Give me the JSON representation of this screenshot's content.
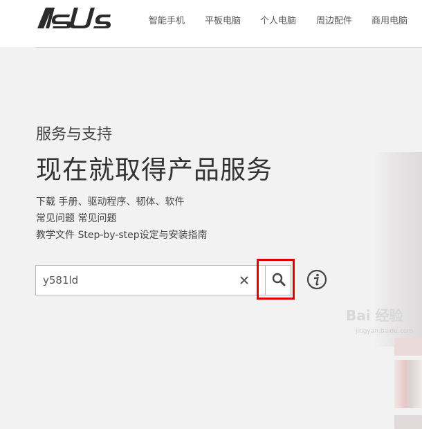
{
  "header": {
    "logo_text": "ASUS",
    "nav": [
      "智能手机",
      "平板电脑",
      "个人电脑",
      "周边配件",
      "商用电脑"
    ]
  },
  "hero": {
    "subtitle": "服务与支持",
    "title": "现在就取得产品服务",
    "links": [
      "下载 手册、驱动程序、韧体、软件",
      "常见问题 常见问题",
      "教学文件 Step-by-step设定与安装指南"
    ]
  },
  "search": {
    "value": "y581ld",
    "clear_icon": "close-icon",
    "search_icon": "search-icon",
    "info_icon": "info-icon",
    "highlight_color": "#e00000"
  },
  "watermark": {
    "main": "Bai 经验",
    "sub": "jingyan.baidu.com"
  }
}
